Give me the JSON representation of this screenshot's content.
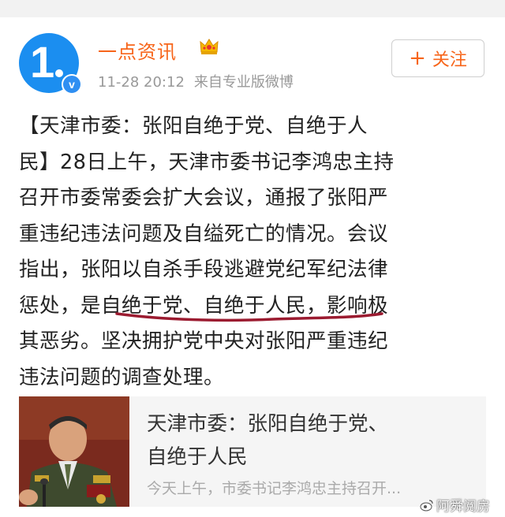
{
  "post": {
    "username": "一点资讯",
    "time": "11-28 20:12",
    "source": "来自专业版微博",
    "follow_label": "关注",
    "text": "【天津市委：张阳自绝于党、自绝于人\n民】28日上午，天津市委书记李鸿忠主持\n召开市委常委会扩大会议，通报了张阳严\n重违纪违法问题及自缢死亡的情况。会议\n指出，张阳以自杀手段逃避党纪军纪法律\n惩处，是自绝于党、自绝于人民，影响极\n其恶劣。坚决拥护党中央对张阳严重违纪\n违法问题的调查处理。"
  },
  "card": {
    "title": "天津市委：张阳自绝于党、\n自绝于人民",
    "desc": "今天上午，市委书记李鸿忠主持召开..."
  },
  "watermark": "阿舜阅房",
  "colors": {
    "accent": "#f7651a",
    "avatar_blue": "#1b8ef0",
    "underline_red": "#9b1b30"
  }
}
